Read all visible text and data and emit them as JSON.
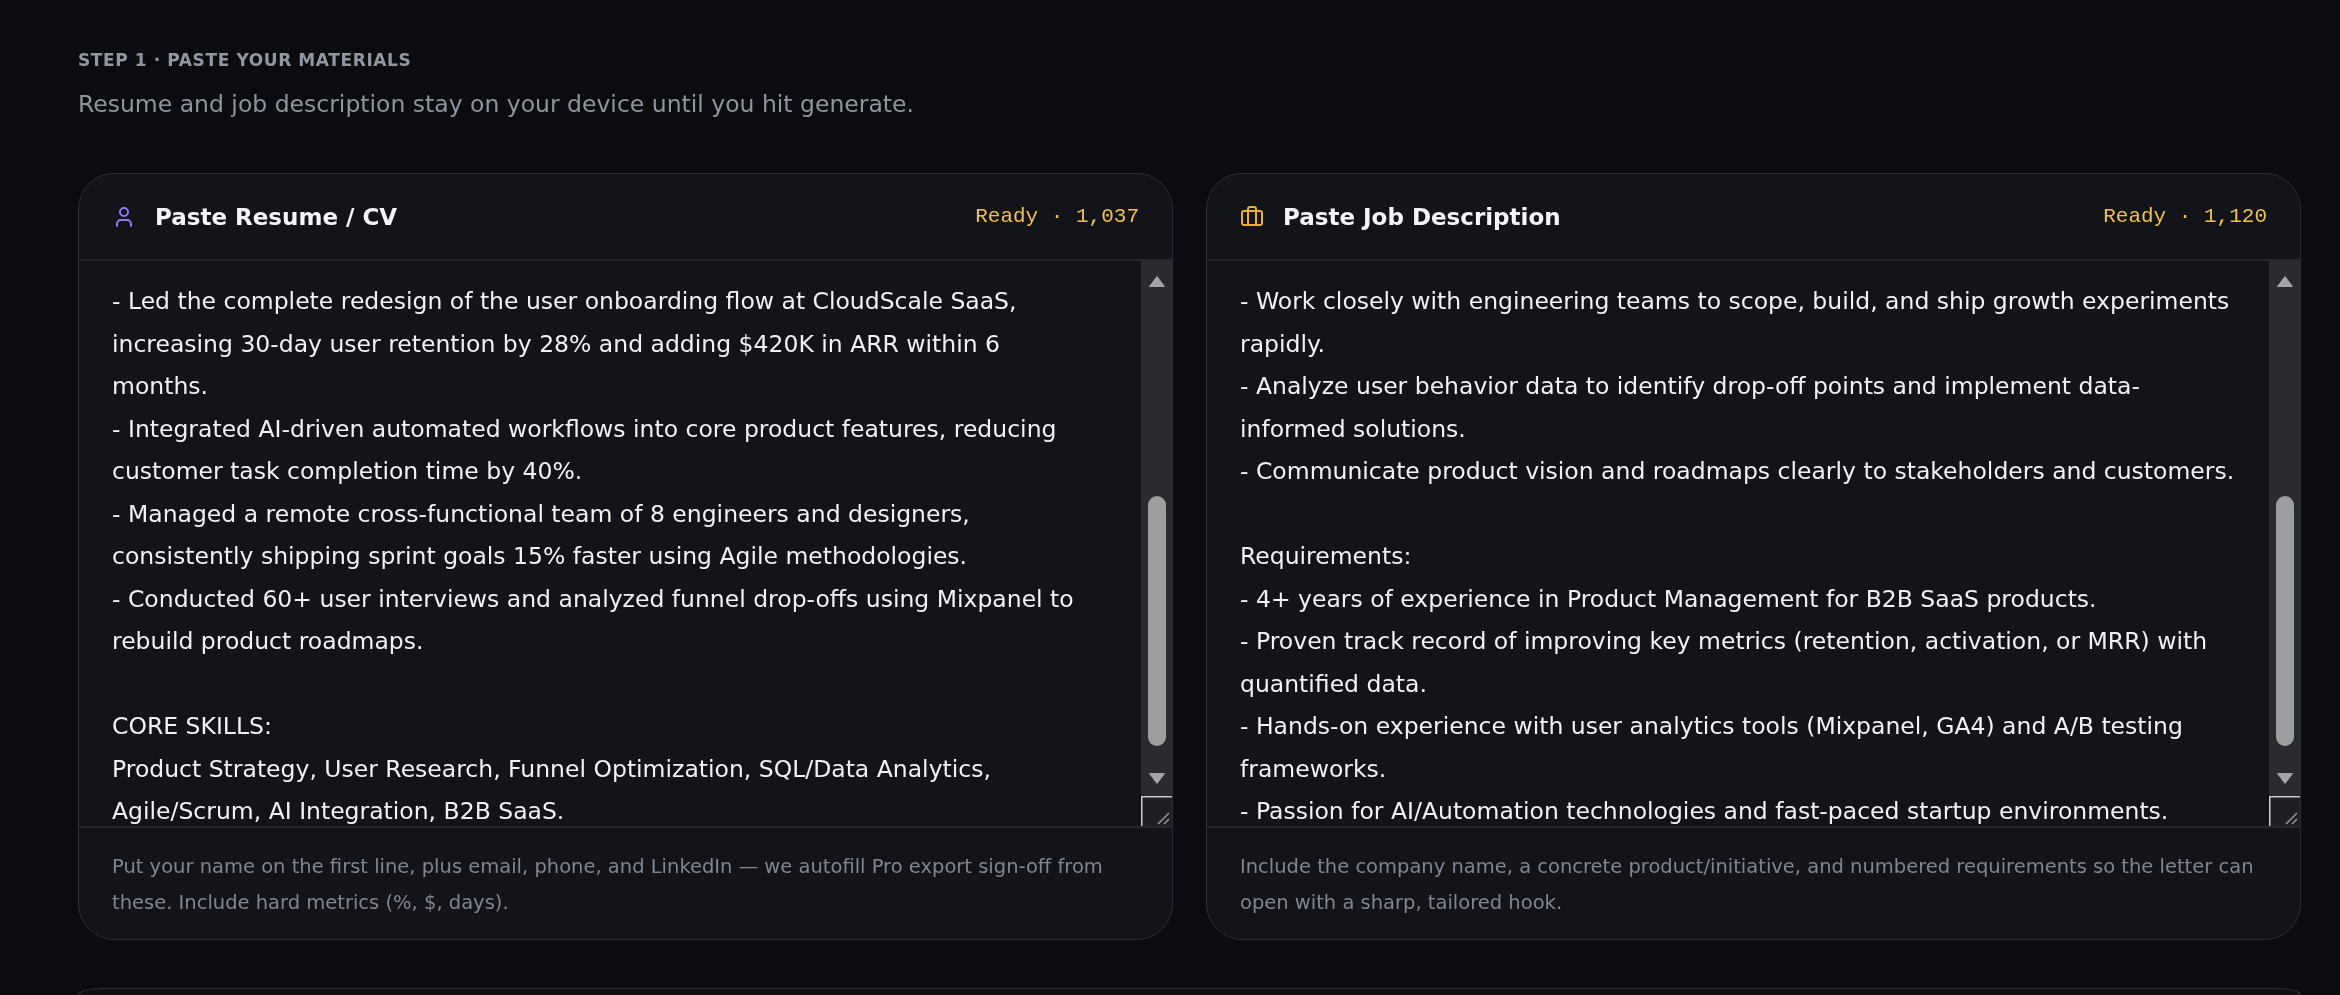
{
  "step": {
    "label": "STEP 1 · PASTE YOUR MATERIALS",
    "subtitle": "Resume and job description stay on your device until you hit generate."
  },
  "panels": [
    {
      "kind": "resume",
      "title": "Paste Resume / CV",
      "status": "Ready · 1,037",
      "value": "- Led the complete redesign of the user onboarding flow at CloudScale SaaS,\nincreasing 30-day user retention by 28% and adding $420K in ARR within 6\nmonths.\n- Integrated AI-driven automated workflows into core product features, reducing\ncustomer task completion time by 40%.\n- Managed a remote cross-functional team of 8 engineers and designers,\nconsistently shipping sprint goals 15% faster using Agile methodologies.\n- Conducted 60+ user interviews and analyzed funnel drop-offs using Mixpanel to\nrebuild product roadmaps.\n\nCORE SKILLS:\nProduct Strategy, User Research, Funnel Optimization, SQL/Data Analytics,\nAgile/Scrum, AI Integration, B2B SaaS.",
      "hint": "Put your name on the first line, plus email, phone, and LinkedIn — we autofill Pro export sign-off from these. Include hard metrics (%, $, days)."
    },
    {
      "kind": "job",
      "title": "Paste Job Description",
      "status": "Ready · 1,120",
      "value": "- Work closely with engineering teams to scope, build, and ship growth experiments\nrapidly.\n- Analyze user behavior data to identify drop-off points and implement data-\ninformed solutions.\n- Communicate product vision and roadmaps clearly to stakeholders and customers.\n\nRequirements:\n- 4+ years of experience in Product Management for B2B SaaS products.\n- Proven track record of improving key metrics (retention, activation, or MRR) with\nquantified data.\n- Hands-on experience with user analytics tools (Mixpanel, GA4) and A/B testing\nframeworks.\n- Passion for AI/Automation technologies and fast-paced startup environments.",
      "hint": "Include the company name, a concrete product/initiative, and numbered requirements so the letter can open with a sharp, tailored hook."
    }
  ]
}
